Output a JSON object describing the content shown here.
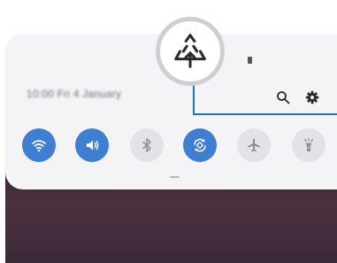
{
  "status_bar": {
    "battery_icon": "battery-icon"
  },
  "panel": {
    "datetime": "10:00 Fri 4 January",
    "top_icons": [
      {
        "name": "search-icon"
      },
      {
        "name": "settings-icon"
      }
    ]
  },
  "quick_settings": [
    {
      "name": "wifi",
      "icon": "wifi-icon",
      "state": "on"
    },
    {
      "name": "sound",
      "icon": "sound-icon",
      "state": "on"
    },
    {
      "name": "bluetooth",
      "icon": "bluetooth-icon",
      "state": "off"
    },
    {
      "name": "auto-rotate",
      "icon": "auto-rotate-icon",
      "state": "on"
    },
    {
      "name": "airplane-mode",
      "icon": "airplane-icon",
      "state": "off"
    },
    {
      "name": "flashlight",
      "icon": "flashlight-icon",
      "state": "off"
    }
  ],
  "callout_icon": "recycle-icon",
  "colors": {
    "accent": "#3e7fd2",
    "highlight": "#1a73c9",
    "panel": "#f4f4f6"
  }
}
